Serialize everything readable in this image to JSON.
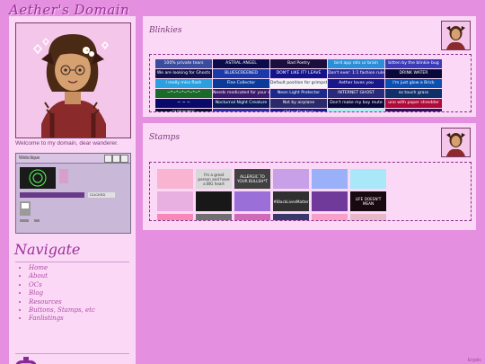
{
  "site": {
    "title": "Aether's Domain",
    "credit": "Eryptic"
  },
  "sidebar": {
    "welcome": "Welcome to my domain, dear wanderer.",
    "widget": {
      "title": "Webclique",
      "badge_label": "CLICKED"
    },
    "nav_heading": "Navigate",
    "nav_items": [
      {
        "label": "Home"
      },
      {
        "label": "About"
      },
      {
        "label": "OCs"
      },
      {
        "label": "Blog"
      },
      {
        "label": "Resources"
      },
      {
        "label": "Buttons, Stamps, etc"
      },
      {
        "label": "Fanlistings"
      }
    ]
  },
  "blinkies_panel": {
    "heading": "Blinkies",
    "blinkies": [
      {
        "text": "100% private tears",
        "bg": "#3b4b9e"
      },
      {
        "text": "ASTRAL ANGEL",
        "bg": "#0c0c4a"
      },
      {
        "text": "Bad Poetry",
        "bg": "#1c0f3e"
      },
      {
        "text": "bird app rots ur brain",
        "bg": "#2b8fd8"
      },
      {
        "text": "bitten by the blinkie bug",
        "bg": "#3b3bb8"
      },
      {
        "text": "We are looking for Ghosts",
        "bg": "#10104a"
      },
      {
        "text": "BLUESCREENED",
        "bg": "#1a3aaa"
      },
      {
        "text": "DON'T LIKE IT? LEAVE",
        "bg": "#14148a"
      },
      {
        "text": "Don't ever: 1:1 fashion rules",
        "bg": "#2a2a9a"
      },
      {
        "text": "DRINK WATER",
        "bg": "#0a0a3a"
      },
      {
        "text": "i really miss flash",
        "bg": "#2aa0e0"
      },
      {
        "text": "Fine Collector",
        "bg": "#0a3a9a"
      },
      {
        "text": "Default position for grimpsters",
        "bg": "#f4f4f4"
      },
      {
        "text": "Aether loves you",
        "bg": "#18188a"
      },
      {
        "text": "I'm just glow a Brick",
        "bg": "#0a50b0"
      },
      {
        "text": "~*~*~*~*~*~*",
        "bg": "#1a6a2a"
      },
      {
        "text": "Needs medicated for your safety",
        "bg": "#3a1a6a"
      },
      {
        "text": "Neon Light Protector",
        "bg": "#1a2a8a"
      },
      {
        "text": "INTERNET GHOST",
        "bg": "#2a2a7a"
      },
      {
        "text": "so touch grass",
        "bg": "#10306a"
      },
      {
        "text": "~ ~ ~",
        "bg": "#0a0a6a"
      },
      {
        "text": "Nocturnal Night Creature",
        "bg": "#0a1a5a"
      },
      {
        "text": "Not by airplane",
        "bg": "#2a2a6a"
      },
      {
        "text": "Don't make my boy mute",
        "bg": "#0a0a3a"
      },
      {
        "text": "uno with paper shredder",
        "bg": "#b00a3a"
      },
      {
        "text": "SURVIVING",
        "bg": "#0a0a3a"
      },
      {
        "text": "~ ~",
        "bg": "#2a2a9a"
      },
      {
        "text": "Video Nerdout",
        "bg": "#1a1a8a"
      },
      {
        "text": "",
        "bg": "#a0f0f0"
      },
      {
        "text": "",
        "bg": "#3a0a5a"
      }
    ]
  },
  "stamps_panel": {
    "heading": "Stamps",
    "stamps": [
      {
        "text": "",
        "bg": "#f8b4d0"
      },
      {
        "text": "I'm a great person and have a BIG heart",
        "bg": "#d8d8d8"
      },
      {
        "text": "ALLERGIC TO YOUR BULLSH*T",
        "bg": "#404040"
      },
      {
        "text": "",
        "bg": "#c8a0e8"
      },
      {
        "text": "",
        "bg": "#9ab0f8"
      },
      {
        "text": "",
        "bg": "#a8e8f8"
      },
      {
        "text": "",
        "bg": "#e8b0e0"
      },
      {
        "text": "",
        "bg": "#181818"
      },
      {
        "text": "",
        "bg": "#9a70d8"
      },
      {
        "text": "#BlackLivesMatter",
        "bg": "#303030"
      },
      {
        "text": "",
        "bg": "#703a9a"
      },
      {
        "text": "LIFE DOESN'T MEAN",
        "bg": "#180810"
      },
      {
        "text": "",
        "bg": "#f888b8"
      },
      {
        "text": "",
        "bg": "#707070"
      },
      {
        "text": "",
        "bg": "#d06ab8"
      },
      {
        "text": "",
        "bg": "#3a3a6a"
      },
      {
        "text": "",
        "bg": "#f8a0c8"
      },
      {
        "text": "",
        "bg": "#e8b8c8"
      }
    ]
  }
}
